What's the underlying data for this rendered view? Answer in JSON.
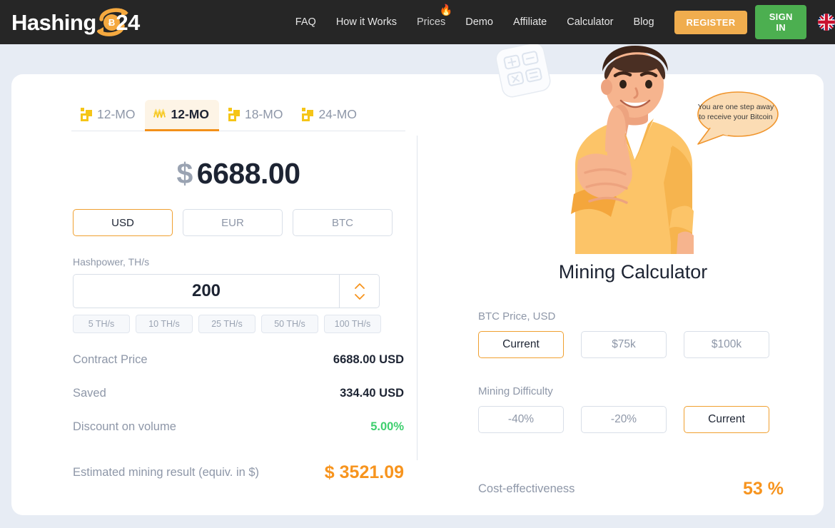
{
  "header": {
    "logo": {
      "text": "Hashing",
      "suffix": "24",
      "coin_symbol": "Ƀ",
      "icon": "hashing24-logo"
    },
    "nav": [
      {
        "label": "FAQ",
        "icon": null
      },
      {
        "label": "How it Works",
        "icon": null
      },
      {
        "label": "Prices",
        "icon": "fire-icon"
      },
      {
        "label": "Demo",
        "icon": null
      },
      {
        "label": "Affiliate",
        "icon": null
      },
      {
        "label": "Calculator",
        "icon": null
      },
      {
        "label": "Blog",
        "icon": null
      }
    ],
    "register_label": "REGISTER",
    "signin_label": "SIGN IN",
    "language_icon": "uk-flag-icon",
    "colors": {
      "bar": "#262626",
      "register": "#f0ad4e",
      "signin": "#4caf50"
    }
  },
  "calculator": {
    "tabs": [
      {
        "label": "12-MO",
        "icon": "contract-block-icon",
        "active": false
      },
      {
        "label": "12-MO",
        "icon": "hashrate-wave-icon",
        "active": true
      },
      {
        "label": "18-MO",
        "icon": "contract-block-icon",
        "active": false
      },
      {
        "label": "24-MO",
        "icon": "contract-block-icon",
        "active": false
      }
    ],
    "price": {
      "currency_symbol": "$",
      "amount": "6688.00"
    },
    "currencies": [
      {
        "label": "USD",
        "active": true
      },
      {
        "label": "EUR",
        "active": false
      },
      {
        "label": "BTC",
        "active": false
      }
    ],
    "hashpower": {
      "label": "Hashpower, TH/s",
      "value": "200",
      "placeholder": "200",
      "stepper_icon": "stepper-chevrons-icon",
      "presets": [
        "5 TH/s",
        "10 TH/s",
        "25 TH/s",
        "50 TH/s",
        "100 TH/s"
      ]
    },
    "details": [
      {
        "label": "Contract Price",
        "value": "6688.00 USD",
        "style": "dark"
      },
      {
        "label": "Saved",
        "value": "334.40 USD",
        "style": "dark"
      },
      {
        "label": "Discount on volume",
        "value": "5.00%",
        "style": "green"
      }
    ],
    "summary": {
      "label": "Estimated mining result (equiv. in $)",
      "value": "$ 3521.09"
    }
  },
  "panel": {
    "title": "Mining Calculator",
    "bubble_text": "You are one step away to receive your Bitcoin",
    "illustration_icons": {
      "calculator": "calculator-icon",
      "hero": "thumbs-up-person-illustration",
      "bubble": "speech-bubble-icon"
    },
    "btc_price": {
      "label": "BTC Price, USD",
      "options": [
        {
          "label": "Current",
          "active": true
        },
        {
          "label": "$75k",
          "active": false
        },
        {
          "label": "$100k",
          "active": false
        }
      ]
    },
    "mining_difficulty": {
      "label": "Mining Difficulty",
      "options": [
        {
          "label": "-40%",
          "active": false
        },
        {
          "label": "-20%",
          "active": false
        },
        {
          "label": "Current",
          "active": true
        }
      ]
    },
    "summary": {
      "label": "Cost-effectiveness",
      "value": "53 %"
    }
  },
  "colors": {
    "accent_orange": "#f7941e",
    "accent_border": "#f0a030",
    "green": "#3ecf6e",
    "page_bg": "#e7ecf4",
    "text_muted": "#8e97a8",
    "text_dark": "#1d2433"
  }
}
